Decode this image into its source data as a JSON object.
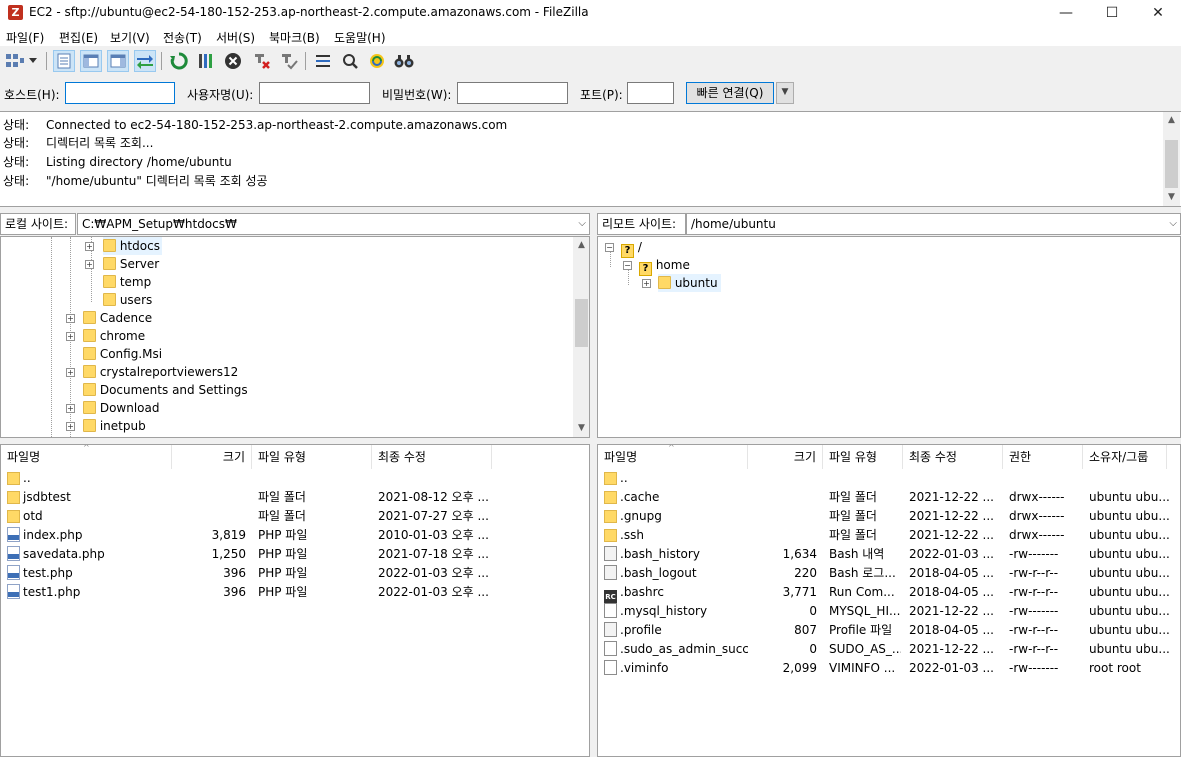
{
  "window": {
    "title": "EC2 - sftp://ubuntu@ec2-54-180-152-253.ap-northeast-2.compute.amazonaws.com - FileZilla",
    "app_icon_glyph": "Z",
    "minimize": "—",
    "maximize": "☐",
    "close": "✕"
  },
  "menu": [
    "파일(F)",
    "편집(E)",
    "보기(V)",
    "전송(T)",
    "서버(S)",
    "북마크(B)",
    "도움말(H)"
  ],
  "quickconnect": {
    "host_label": "호스트(H):",
    "host_value": "",
    "user_label": "사용자명(U):",
    "user_value": "",
    "pass_label": "비밀번호(W):",
    "pass_value": "",
    "port_label": "포트(P):",
    "port_value": "",
    "connect_label": "빠른 연결(Q)",
    "dropdown_glyph": "▼"
  },
  "log": [
    {
      "label": "상태:",
      "text": "Connected to ec2-54-180-152-253.ap-northeast-2.compute.amazonaws.com"
    },
    {
      "label": "상태:",
      "text": "디렉터리 목록 조회..."
    },
    {
      "label": "상태:",
      "text": "Listing directory /home/ubuntu"
    },
    {
      "label": "상태:",
      "text": "\"/home/ubuntu\" 디렉터리 목록 조회 성공"
    }
  ],
  "local": {
    "site_label": "로컬 사이트:",
    "site_path": "C:₩APM_Setup₩htdocs₩",
    "tree": [
      {
        "name": "htdocs",
        "expander": "+"
      },
      {
        "name": "Server",
        "expander": "+"
      },
      {
        "name": "temp",
        "expander": ""
      },
      {
        "name": "users",
        "expander": ""
      },
      {
        "name": "Cadence",
        "expander": "+"
      },
      {
        "name": "chrome",
        "expander": "+"
      },
      {
        "name": "Config.Msi",
        "expander": ""
      },
      {
        "name": "crystalreportviewers12",
        "expander": "+"
      },
      {
        "name": "Documents and Settings",
        "expander": ""
      },
      {
        "name": "Download",
        "expander": "+"
      },
      {
        "name": "inetpub",
        "expander": "+"
      }
    ],
    "columns": [
      "파일명",
      "크기",
      "파일 유형",
      "최종 수정"
    ],
    "files": [
      {
        "name": "..",
        "size": "",
        "type": "",
        "modified": "",
        "icon": "folder"
      },
      {
        "name": "jsdbtest",
        "size": "",
        "type": "파일 폴더",
        "modified": "2021-08-12 오후 ...",
        "icon": "folder"
      },
      {
        "name": "otd",
        "size": "",
        "type": "파일 폴더",
        "modified": "2021-07-27 오후 ...",
        "icon": "folder"
      },
      {
        "name": "index.php",
        "size": "3,819",
        "type": "PHP 파일",
        "modified": "2010-01-03 오후 ...",
        "icon": "php"
      },
      {
        "name": "savedata.php",
        "size": "1,250",
        "type": "PHP 파일",
        "modified": "2021-07-18 오후 ...",
        "icon": "php"
      },
      {
        "name": "test.php",
        "size": "396",
        "type": "PHP 파일",
        "modified": "2022-01-03 오후 ...",
        "icon": "php"
      },
      {
        "name": "test1.php",
        "size": "396",
        "type": "PHP 파일",
        "modified": "2022-01-03 오후 ...",
        "icon": "php"
      }
    ]
  },
  "remote": {
    "site_label": "리모트 사이트:",
    "site_path": "/home/ubuntu",
    "tree": [
      {
        "name": "/",
        "expander": "−"
      },
      {
        "name": "home",
        "expander": "−"
      },
      {
        "name": "ubuntu",
        "expander": "+"
      }
    ],
    "tree_unknown_glyph": "?",
    "columns": [
      "파일명",
      "크기",
      "파일 유형",
      "최종 수정",
      "권한",
      "소유자/그룹"
    ],
    "files": [
      {
        "name": "..",
        "size": "",
        "type": "",
        "modified": "",
        "perms": "",
        "owner": "",
        "icon": "folder"
      },
      {
        "name": ".cache",
        "size": "",
        "type": "파일 폴더",
        "modified": "2021-12-22 ...",
        "perms": "drwx------",
        "owner": "ubuntu ubu...",
        "icon": "folder"
      },
      {
        "name": ".gnupg",
        "size": "",
        "type": "파일 폴더",
        "modified": "2021-12-22 ...",
        "perms": "drwx------",
        "owner": "ubuntu ubu...",
        "icon": "folder"
      },
      {
        "name": ".ssh",
        "size": "",
        "type": "파일 폴더",
        "modified": "2021-12-22 ...",
        "perms": "drwx------",
        "owner": "ubuntu ubu...",
        "icon": "folder"
      },
      {
        "name": ".bash_history",
        "size": "1,634",
        "type": "Bash 내역",
        "modified": "2022-01-03 ...",
        "perms": "-rw-------",
        "owner": "ubuntu ubu...",
        "icon": "gen"
      },
      {
        "name": ".bash_logout",
        "size": "220",
        "type": "Bash 로그...",
        "modified": "2018-04-05 ...",
        "perms": "-rw-r--r--",
        "owner": "ubuntu ubu...",
        "icon": "gen"
      },
      {
        "name": ".bashrc",
        "size": "3,771",
        "type": "Run Com...",
        "modified": "2018-04-05 ...",
        "perms": "-rw-r--r--",
        "owner": "ubuntu ubu...",
        "icon": "rc"
      },
      {
        "name": ".mysql_history",
        "size": "0",
        "type": "MYSQL_HI...",
        "modified": "2021-12-22 ...",
        "perms": "-rw-------",
        "owner": "ubuntu ubu...",
        "icon": "blank"
      },
      {
        "name": ".profile",
        "size": "807",
        "type": "Profile 파일",
        "modified": "2018-04-05 ...",
        "perms": "-rw-r--r--",
        "owner": "ubuntu ubu...",
        "icon": "gen"
      },
      {
        "name": ".sudo_as_admin_succ...",
        "size": "0",
        "type": "SUDO_AS_...",
        "modified": "2021-12-22 ...",
        "perms": "-rw-r--r--",
        "owner": "ubuntu ubu...",
        "icon": "blank"
      },
      {
        "name": ".viminfo",
        "size": "2,099",
        "type": "VIMINFO ...",
        "modified": "2022-01-03 ...",
        "perms": "-rw-------",
        "owner": "root root",
        "icon": "blank"
      }
    ]
  },
  "toolbar_icons": [
    "site-manager-icon",
    "site-manager-dropdown-icon",
    "toggle-log-icon",
    "toggle-local-tree-icon",
    "toggle-remote-tree-icon",
    "toggle-queue-icon",
    "refresh-icon",
    "process-queue-icon",
    "cancel-icon",
    "disconnect-icon",
    "reconnect-icon",
    "directory-filter-icon",
    "compare-icon",
    "sync-browse-icon",
    "search-icon"
  ]
}
